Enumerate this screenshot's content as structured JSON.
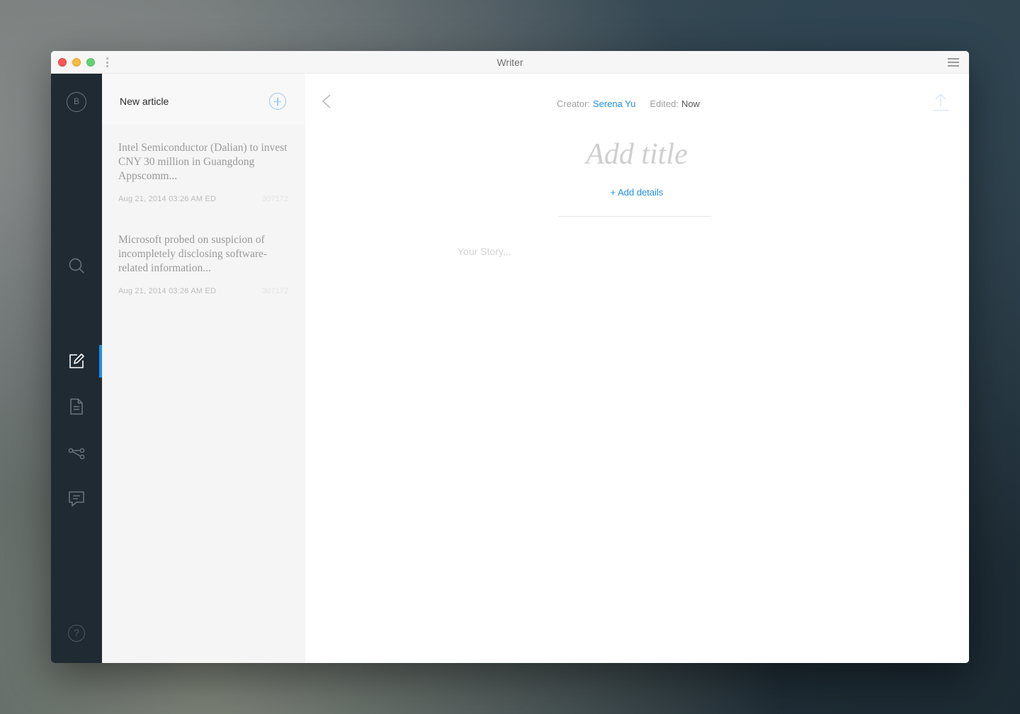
{
  "window": {
    "title": "Writer"
  },
  "sidebar": {
    "brand_letter": "B",
    "items": [
      {
        "name": "search",
        "icon": "search-icon"
      },
      {
        "name": "write",
        "icon": "edit-icon",
        "active": true
      },
      {
        "name": "documents",
        "icon": "document-icon"
      },
      {
        "name": "share",
        "icon": "share-icon"
      },
      {
        "name": "comments",
        "icon": "comment-icon"
      }
    ],
    "help_label": "?"
  },
  "list": {
    "header_title": "New article",
    "articles": [
      {
        "title": "Intel Semiconductor (Dalian) to invest CNY 30 million in Guangdong Appscomm...",
        "date": "Aug 21, 2014 03:26 AM ED",
        "id": "307172"
      },
      {
        "title": "Microsoft probed on suspicion of incompletely disclosing software-related information...",
        "date": "Aug 21, 2014 03:26 AM ED",
        "id": "307172"
      }
    ]
  },
  "editor": {
    "creator_label": "Creator:",
    "creator_name": "Serena Yu",
    "edited_label": "Edited:",
    "edited_value": "Now",
    "title_placeholder": "Add title",
    "add_details": "+ Add details",
    "story_placeholder": "Your Story..."
  },
  "colors": {
    "accent": "#1f8fe6",
    "sidebar_bg": "#1f2a33",
    "list_bg": "#f5f5f5"
  }
}
